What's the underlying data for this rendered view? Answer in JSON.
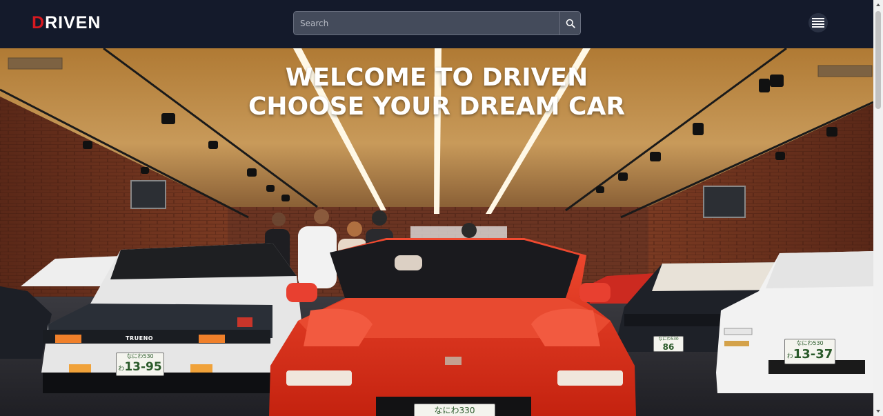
{
  "brand": {
    "logo_accent": "D",
    "logo_rest": "RIVEN",
    "accent_color": "#d71920"
  },
  "search": {
    "placeholder": "Search",
    "value": "",
    "icon": "search-icon"
  },
  "menu": {
    "icon": "hamburger-menu-icon"
  },
  "hero": {
    "line1": "WELCOME TO DRIVEN",
    "line2": "CHOOSE YOUR DREAM CAR",
    "image_subject": "car showroom with classic Japanese sports cars"
  },
  "plates": {
    "left": {
      "top": "なにわ530",
      "prefix": "わ",
      "number": "13-95"
    },
    "right_front": {
      "top": "なにわ530",
      "prefix": "わ",
      "number": "13-37"
    },
    "right_mid": {
      "top": "なにわ530",
      "prefix": "",
      "number": "86"
    },
    "center": {
      "top": "なにわ330",
      "prefix": "",
      "number": ""
    },
    "left_badge": "TRUENO"
  },
  "colors": {
    "navbar": "#141a2b",
    "search_bg": "#444b5b",
    "hero_car": "#e8321f"
  }
}
